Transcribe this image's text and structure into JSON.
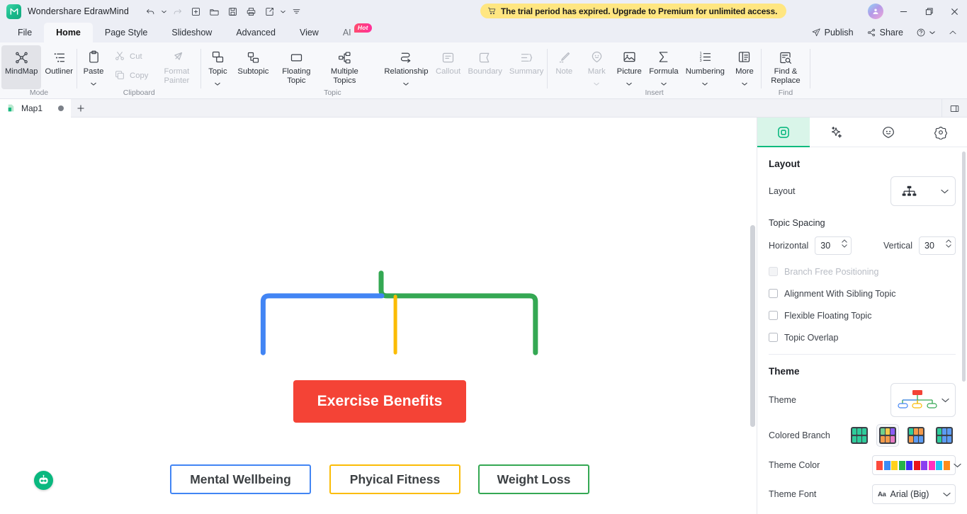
{
  "titlebar": {
    "app_name": "Wondershare EdrawMind",
    "quick_access": [
      {
        "name": "undo-button",
        "icon": "undo-icon",
        "has_caret": true
      },
      {
        "name": "redo-button",
        "icon": "redo-icon",
        "has_caret": false
      },
      {
        "name": "new-button",
        "icon": "plus-square-icon",
        "has_caret": false
      },
      {
        "name": "open-button",
        "icon": "folder-icon",
        "has_caret": false
      },
      {
        "name": "save-button",
        "icon": "save-icon",
        "has_caret": false
      },
      {
        "name": "print-button",
        "icon": "print-icon",
        "has_caret": false
      },
      {
        "name": "export-button",
        "icon": "share-export-icon",
        "has_caret": true
      },
      {
        "name": "customize-qat-button",
        "icon": "more-options-icon",
        "has_caret": false
      }
    ],
    "trial_banner": {
      "icon": "cart-icon",
      "text": "The trial period has expired. Upgrade to Premium for unlimited access.",
      "bg": "#ffe681"
    },
    "avatar_icon": "user-avatar-icon",
    "window_controls": [
      "minimize",
      "maximize",
      "close"
    ]
  },
  "menubar": {
    "tabs": [
      {
        "label": "File",
        "active": false
      },
      {
        "label": "Home",
        "active": true
      },
      {
        "label": "Page Style",
        "active": false
      },
      {
        "label": "Slideshow",
        "active": false
      },
      {
        "label": "Advanced",
        "active": false
      },
      {
        "label": "View",
        "active": false
      },
      {
        "label": "AI",
        "active": false,
        "badge": "Hot"
      }
    ],
    "right": [
      {
        "label": "Publish",
        "icon": "publish-icon"
      },
      {
        "label": "Share",
        "icon": "share-nodes-icon"
      },
      {
        "label": "",
        "icon": "help-icon",
        "caret": true
      },
      {
        "label": "",
        "icon": "collapse-ribbon-icon"
      }
    ]
  },
  "ribbon": {
    "groups": [
      {
        "label": "Mode",
        "items": [
          {
            "label": "MindMap",
            "icon": "mindmap-icon",
            "active": true,
            "disabled": false
          },
          {
            "label": "Outliner",
            "icon": "outliner-icon",
            "active": false,
            "disabled": false
          }
        ]
      },
      {
        "label": "Clipboard",
        "items": [
          {
            "label": "Paste",
            "icon": "paste-icon",
            "disabled": false,
            "caret": true
          },
          {
            "label": "Cut",
            "icon": "cut-icon",
            "disabled": true
          },
          {
            "label": "Copy",
            "icon": "copy-icon",
            "disabled": true
          },
          {
            "label": "Format Painter",
            "icon": "format-painter-icon",
            "disabled": true
          }
        ]
      },
      {
        "label": "Topic",
        "items": [
          {
            "label": "Topic",
            "icon": "topic-icon",
            "disabled": false,
            "caret": true
          },
          {
            "label": "Subtopic",
            "icon": "subtopic-icon",
            "disabled": false
          },
          {
            "label": "Floating Topic",
            "icon": "floating-topic-icon",
            "disabled": false
          },
          {
            "label": "Multiple Topics",
            "icon": "multiple-topics-icon",
            "disabled": false
          },
          {
            "label": "Relationship",
            "icon": "relationship-icon",
            "disabled": false,
            "caret": true
          },
          {
            "label": "Callout",
            "icon": "callout-icon",
            "disabled": true
          },
          {
            "label": "Boundary",
            "icon": "boundary-icon",
            "disabled": true
          },
          {
            "label": "Summary",
            "icon": "summary-icon",
            "disabled": true
          }
        ]
      },
      {
        "label": "Insert",
        "items": [
          {
            "label": "Note",
            "icon": "note-icon",
            "disabled": true
          },
          {
            "label": "Mark",
            "icon": "mark-icon",
            "disabled": true,
            "caret": true
          },
          {
            "label": "Picture",
            "icon": "picture-icon",
            "disabled": false,
            "caret": true
          },
          {
            "label": "Formula",
            "icon": "formula-icon",
            "disabled": false,
            "caret": true
          },
          {
            "label": "Numbering",
            "icon": "numbering-icon",
            "disabled": false,
            "caret": true
          },
          {
            "label": "More",
            "icon": "more-icon",
            "disabled": false,
            "caret": true
          }
        ]
      },
      {
        "label": "Find",
        "items": [
          {
            "label": "Find & Replace",
            "icon": "find-replace-icon",
            "disabled": false
          }
        ]
      }
    ]
  },
  "doctabs": {
    "tabs": [
      {
        "label": "Map1",
        "icon": "document-icon",
        "modified": true
      }
    ],
    "add_label": "+",
    "panel_toggle_icon": "toggle-right-panel-icon"
  },
  "canvas": {
    "ai_button_icon": "ai-robot-icon",
    "mindmap": {
      "root": {
        "text": "Exercise Benefits",
        "fill": "#f44336",
        "text_color": "#ffffff"
      },
      "children": [
        {
          "text": "Mental Wellbeing",
          "border": "#4285f4",
          "text_color": "#3c4043"
        },
        {
          "text": "Phyical Fitness",
          "border": "#fbbc05",
          "text_color": "#3c4043"
        },
        {
          "text": "Weight Loss",
          "border": "#34a853",
          "text_color": "#3c4043"
        }
      ]
    }
  },
  "right_panel": {
    "tabs": [
      {
        "name": "layout-tab",
        "icon": "layout-square-icon",
        "active": true
      },
      {
        "name": "style-tab",
        "icon": "sparkle-icon",
        "active": false
      },
      {
        "name": "clipart-tab",
        "icon": "smiley-icon",
        "active": false
      },
      {
        "name": "settings-tab",
        "icon": "gear-flower-icon",
        "active": false
      }
    ],
    "layout": {
      "section_title": "Layout",
      "layout_label": "Layout",
      "layout_value_icon": "org-chart-icon",
      "topic_spacing_title": "Topic Spacing",
      "horizontal_label": "Horizontal",
      "horizontal_value": "30",
      "vertical_label": "Vertical",
      "vertical_value": "30",
      "checkboxes": [
        {
          "label": "Branch Free Positioning",
          "checked": false,
          "disabled": true
        },
        {
          "label": "Alignment With Sibling Topic",
          "checked": false,
          "disabled": false
        },
        {
          "label": "Flexible Floating Topic",
          "checked": false,
          "disabled": false
        },
        {
          "label": "Topic Overlap",
          "checked": false,
          "disabled": false
        }
      ]
    },
    "theme": {
      "section_title": "Theme",
      "theme_label": "Theme",
      "colored_branch_label": "Colored Branch",
      "colored_branch_selected_index": 1,
      "colored_branch_options": [
        [
          "#2ecc9b",
          "#2ecc9b",
          "#2ecc9b",
          "#2ecc9b",
          "#2ecc9b",
          "#2ecc9b"
        ],
        [
          "#6ecf8e",
          "#f2c94c",
          "#8b5cf6",
          "#f2994a",
          "#f2994a",
          "#e879c4"
        ],
        [
          "#2ecc9b",
          "#f2994a",
          "#f2994a",
          "#f2994a",
          "#5b9bf3",
          "#5b9bf3"
        ],
        [
          "#2ecc9b",
          "#5b9bf3",
          "#5b9bf3",
          "#2ecc9b",
          "#5b9bf3",
          "#5b9bf3"
        ]
      ],
      "theme_color_label": "Theme Color",
      "theme_colors": [
        "#fc4a3c",
        "#3b8bf5",
        "#ffd11a",
        "#26b34a",
        "#3b2ff5",
        "#e8151b",
        "#8b3ff0",
        "#ff2fbf",
        "#1ec3f5",
        "#ff8c1a"
      ],
      "theme_font_label": "Theme Font",
      "theme_font_value": "Arial (Big)"
    }
  }
}
